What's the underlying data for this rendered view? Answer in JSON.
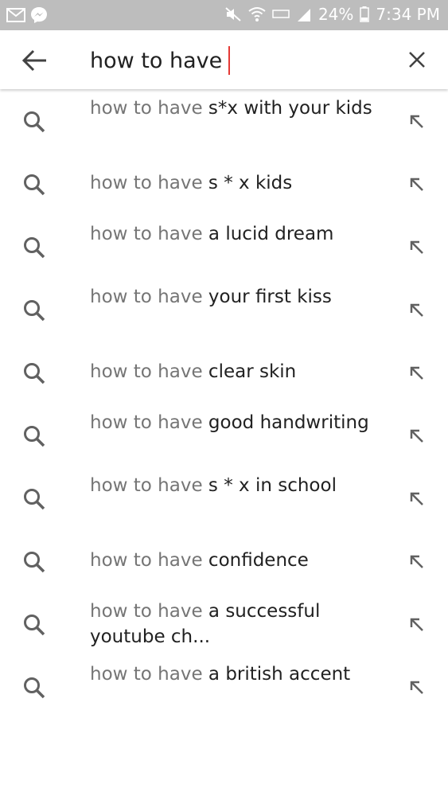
{
  "status_bar": {
    "battery": "24%",
    "time": "7:34 PM"
  },
  "search": {
    "query": "how to have"
  },
  "suggestions": [
    {
      "prefix": "how to have ",
      "completion": "s*x with your kids"
    },
    {
      "prefix": "how to have ",
      "completion": "s * x kids"
    },
    {
      "prefix": "how to have ",
      "completion": "a lucid dream"
    },
    {
      "prefix": "how to have ",
      "completion": "your first kiss"
    },
    {
      "prefix": "how to have ",
      "completion": "clear skin"
    },
    {
      "prefix": "how to have ",
      "completion": "good handwriting"
    },
    {
      "prefix": "how to have ",
      "completion": "s * x in school"
    },
    {
      "prefix": "how to have ",
      "completion": "confidence"
    },
    {
      "prefix": "how to have ",
      "completion": "a successful youtube ch..."
    },
    {
      "prefix": "how to have ",
      "completion": "a british accent"
    }
  ],
  "colors": {
    "status_bar_bg": "#bdbdbd",
    "caret": "#e53935",
    "prefix_text": "#757575",
    "completion_text": "#212121",
    "icon": "#616161"
  }
}
